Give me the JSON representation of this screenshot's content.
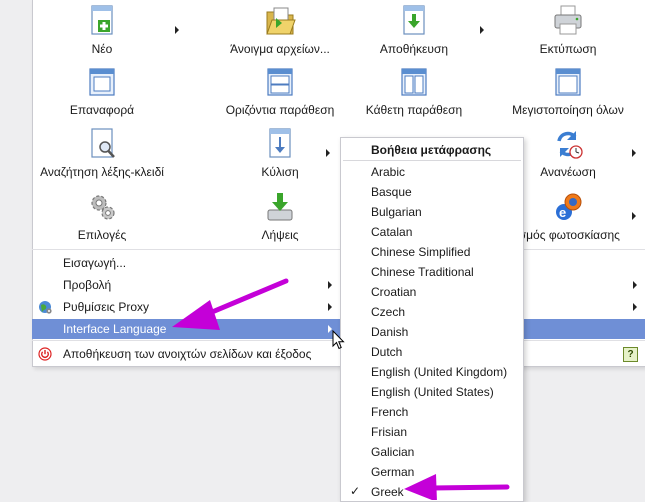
{
  "toolbar_grid": [
    {
      "label": "Νέο",
      "icon": "new-page-icon",
      "submenu": true
    },
    {
      "label": "Άνοιγμα αρχείων...",
      "icon": "open-folder-icon",
      "submenu": false
    },
    {
      "label": "Αποθήκευση",
      "icon": "save-icon",
      "submenu": true
    },
    {
      "label": "Εκτύπωση",
      "icon": "printer-icon",
      "submenu": false
    },
    {
      "label": "Επαναφορά",
      "icon": "restore-window-icon",
      "submenu": false
    },
    {
      "label": "Οριζόντια παράθεση",
      "icon": "tile-horizontal-icon",
      "submenu": false
    },
    {
      "label": "Κάθετη παράθεση",
      "icon": "tile-vertical-icon",
      "submenu": false
    },
    {
      "label": "Μεγιστοποίηση όλων",
      "icon": "maximize-all-icon",
      "submenu": false
    },
    {
      "label": "Αναζήτηση λέξης-κλειδί",
      "icon": "search-keyword-icon",
      "submenu": false
    },
    {
      "label": "Κύλιση",
      "icon": "scroll-icon",
      "submenu": true
    },
    {
      "label": "",
      "icon": "hidden-icon",
      "submenu": false
    },
    {
      "label": "Ανανέωση",
      "icon": "refresh-icon",
      "submenu": true
    },
    {
      "label": "Επιλογές",
      "icon": "gears-icon",
      "submenu": false
    },
    {
      "label": "Λήψεις",
      "icon": "downloads-icon",
      "submenu": false
    },
    {
      "label": "",
      "icon": "hidden-icon",
      "submenu": false
    },
    {
      "label": "ισμός φωτοσκίασης",
      "icon": "browsers-icon",
      "submenu": true
    }
  ],
  "menu_rows": [
    {
      "label": "Εισαγωγή...",
      "icon": "",
      "submenu": false,
      "highlighted": false
    },
    {
      "label": "Προβολή",
      "icon": "",
      "submenu": true,
      "highlighted": false
    },
    {
      "label": "Ρυθμίσεις Proxy",
      "icon": "globe-icon",
      "submenu": true,
      "highlighted": false
    },
    {
      "label": "Interface Language",
      "icon": "",
      "submenu": true,
      "highlighted": true
    }
  ],
  "exit_row": {
    "label": "Αποθήκευση των ανοιχτών σελίδων και έξοδος",
    "icon": "power-icon",
    "help": "?"
  },
  "language_menu": {
    "title": "Βοήθεια μετάφρασης",
    "items": [
      "Arabic",
      "Basque",
      "Bulgarian",
      "Catalan",
      "Chinese Simplified",
      "Chinese Traditional",
      "Croatian",
      "Czech",
      "Danish",
      "Dutch",
      "English (United Kingdom)",
      "English (United States)",
      "French",
      "Frisian",
      "Galician",
      "German",
      "Greek"
    ],
    "checked": "Greek",
    "check_mark": "✓"
  },
  "colors": {
    "highlight": "#6f8fd6",
    "annotation_arrow": "#c400d8"
  }
}
